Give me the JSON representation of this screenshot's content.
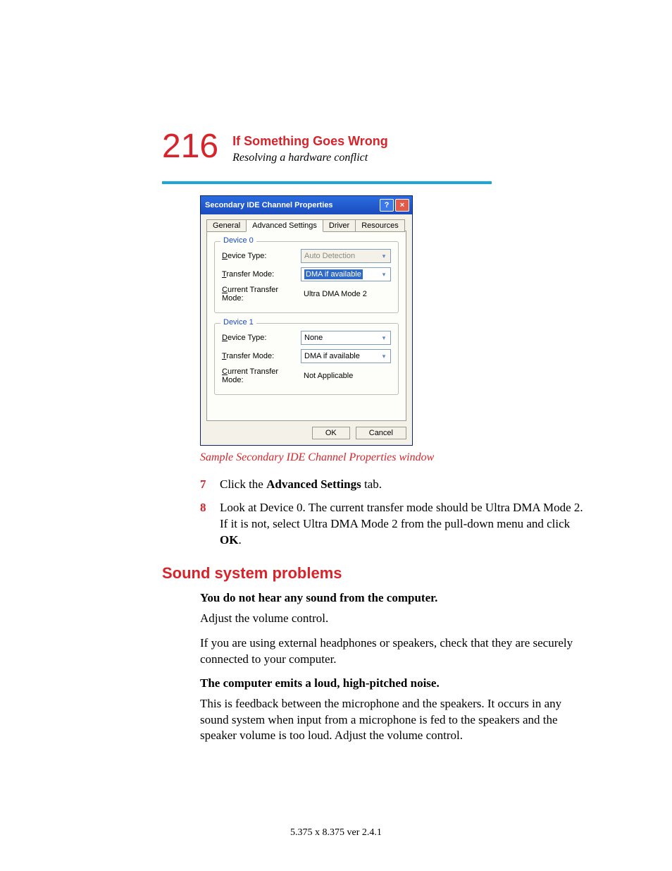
{
  "header": {
    "page_number": "216",
    "title": "If Something Goes Wrong",
    "subtitle": "Resolving a hardware conflict"
  },
  "dialog": {
    "title": "Secondary IDE Channel Properties",
    "help_glyph": "?",
    "close_glyph": "×",
    "tabs": {
      "general": "General",
      "advanced": "Advanced Settings",
      "driver": "Driver",
      "resources": "Resources"
    },
    "device0": {
      "legend": "Device 0",
      "device_type_lbl_u": "D",
      "device_type_lbl_rest": "evice Type:",
      "device_type_val": "Auto Detection",
      "transfer_mode_lbl_u": "T",
      "transfer_mode_lbl_rest": "ransfer Mode:",
      "transfer_mode_val": "DMA if available",
      "current_lbl_u": "C",
      "current_lbl_rest": "urrent Transfer Mode:",
      "current_val": "Ultra DMA Mode 2"
    },
    "device1": {
      "legend": "Device 1",
      "device_type_lbl_u": "D",
      "device_type_lbl_rest": "evice Type:",
      "device_type_val": "None",
      "transfer_mode_lbl_u": "T",
      "transfer_mode_lbl_rest": "ransfer Mode:",
      "transfer_mode_val": "DMA if available",
      "current_lbl_u": "C",
      "current_lbl_rest": "urrent Transfer Mode:",
      "current_val": "Not Applicable"
    },
    "buttons": {
      "ok": "OK",
      "cancel": "Cancel"
    }
  },
  "figcaption": "Sample Secondary IDE Channel Properties window",
  "steps": {
    "s7": {
      "num": "7",
      "pre": "Click the ",
      "bold": "Advanced Settings",
      "post": " tab."
    },
    "s8": {
      "num": "8",
      "pre": "Look at Device 0. The current transfer mode should be Ultra DMA Mode 2. If it is not, select Ultra DMA Mode 2 from the pull-down menu and click ",
      "bold": "OK",
      "post": "."
    }
  },
  "section": {
    "heading": "Sound system problems",
    "p1_title": "You do not hear any sound from the computer.",
    "p1_a": "Adjust the volume control.",
    "p1_b": "If you are using external headphones or speakers, check that they are securely connected to your computer.",
    "p2_title": "The computer emits a loud, high-pitched noise.",
    "p2_a": "This is feedback between the microphone and the speakers. It occurs in any sound system when input from a microphone is fed to the speakers and the speaker volume is too loud. Adjust the volume control."
  },
  "footer": "5.375 x 8.375 ver 2.4.1"
}
